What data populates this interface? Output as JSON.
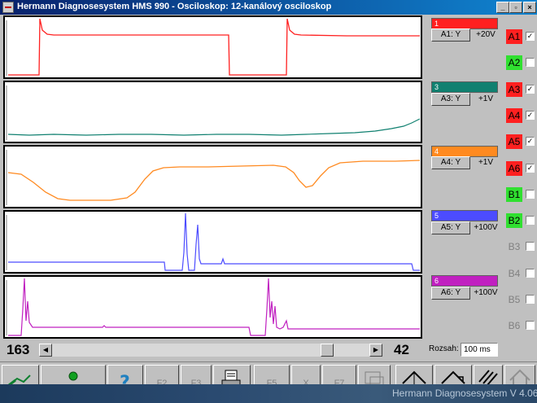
{
  "window": {
    "title": "Hermann Diagnosesystem HMS 990 - Osciloskop: 12-kanálový osciloskop",
    "controls": {
      "minimize": "_",
      "restore": "▫",
      "close": "×"
    }
  },
  "channels": [
    {
      "index": "1",
      "button": "A1: Y",
      "scale": "+20V",
      "color": "#ff2020"
    },
    {
      "index": "3",
      "button": "A3: Y",
      "scale": "+1V",
      "color": "#108070"
    },
    {
      "index": "4",
      "button": "A4: Y",
      "scale": "+1V",
      "color": "#ff8a20"
    },
    {
      "index": "5",
      "button": "A5: Y",
      "scale": "+100V",
      "color": "#4c4cff"
    },
    {
      "index": "6",
      "button": "A6: Y",
      "scale": "+100V",
      "color": "#c020c0"
    }
  ],
  "selector": [
    {
      "label": "A1",
      "checked": true,
      "color": "#ff2020",
      "mark": "✓"
    },
    {
      "label": "A2",
      "checked": false,
      "color": "#30e030",
      "mark": ""
    },
    {
      "label": "A3",
      "checked": true,
      "color": "#ff2020",
      "mark": "✓"
    },
    {
      "label": "A4",
      "checked": true,
      "color": "#ff2020",
      "mark": "✓"
    },
    {
      "label": "A5",
      "checked": true,
      "color": "#ff2020",
      "mark": "✓"
    },
    {
      "label": "A6",
      "checked": true,
      "color": "#ff2020",
      "mark": "✓"
    },
    {
      "label": "B1",
      "checked": false,
      "color": "#30e030",
      "mark": ""
    },
    {
      "label": "B2",
      "checked": false,
      "color": "#30e030",
      "mark": ""
    },
    {
      "label": "B3",
      "checked": false,
      "color": "",
      "mark": ""
    },
    {
      "label": "B4",
      "checked": false,
      "color": "",
      "mark": ""
    },
    {
      "label": "B5",
      "checked": false,
      "color": "",
      "mark": ""
    },
    {
      "label": "B6",
      "checked": false,
      "color": "",
      "mark": ""
    }
  ],
  "scroll": {
    "left_value": "163",
    "right_value": "42",
    "left_arrow": "◀",
    "right_arrow": "▶"
  },
  "range": {
    "label": "Rozsah:",
    "value": "100 ms"
  },
  "toolbar": {
    "f2": "F2",
    "f3": "F3",
    "f5": "F5",
    "f7": "F7",
    "x": "X"
  },
  "footer": {
    "version": "Hermann Diagnosesystem V 4.06"
  }
}
